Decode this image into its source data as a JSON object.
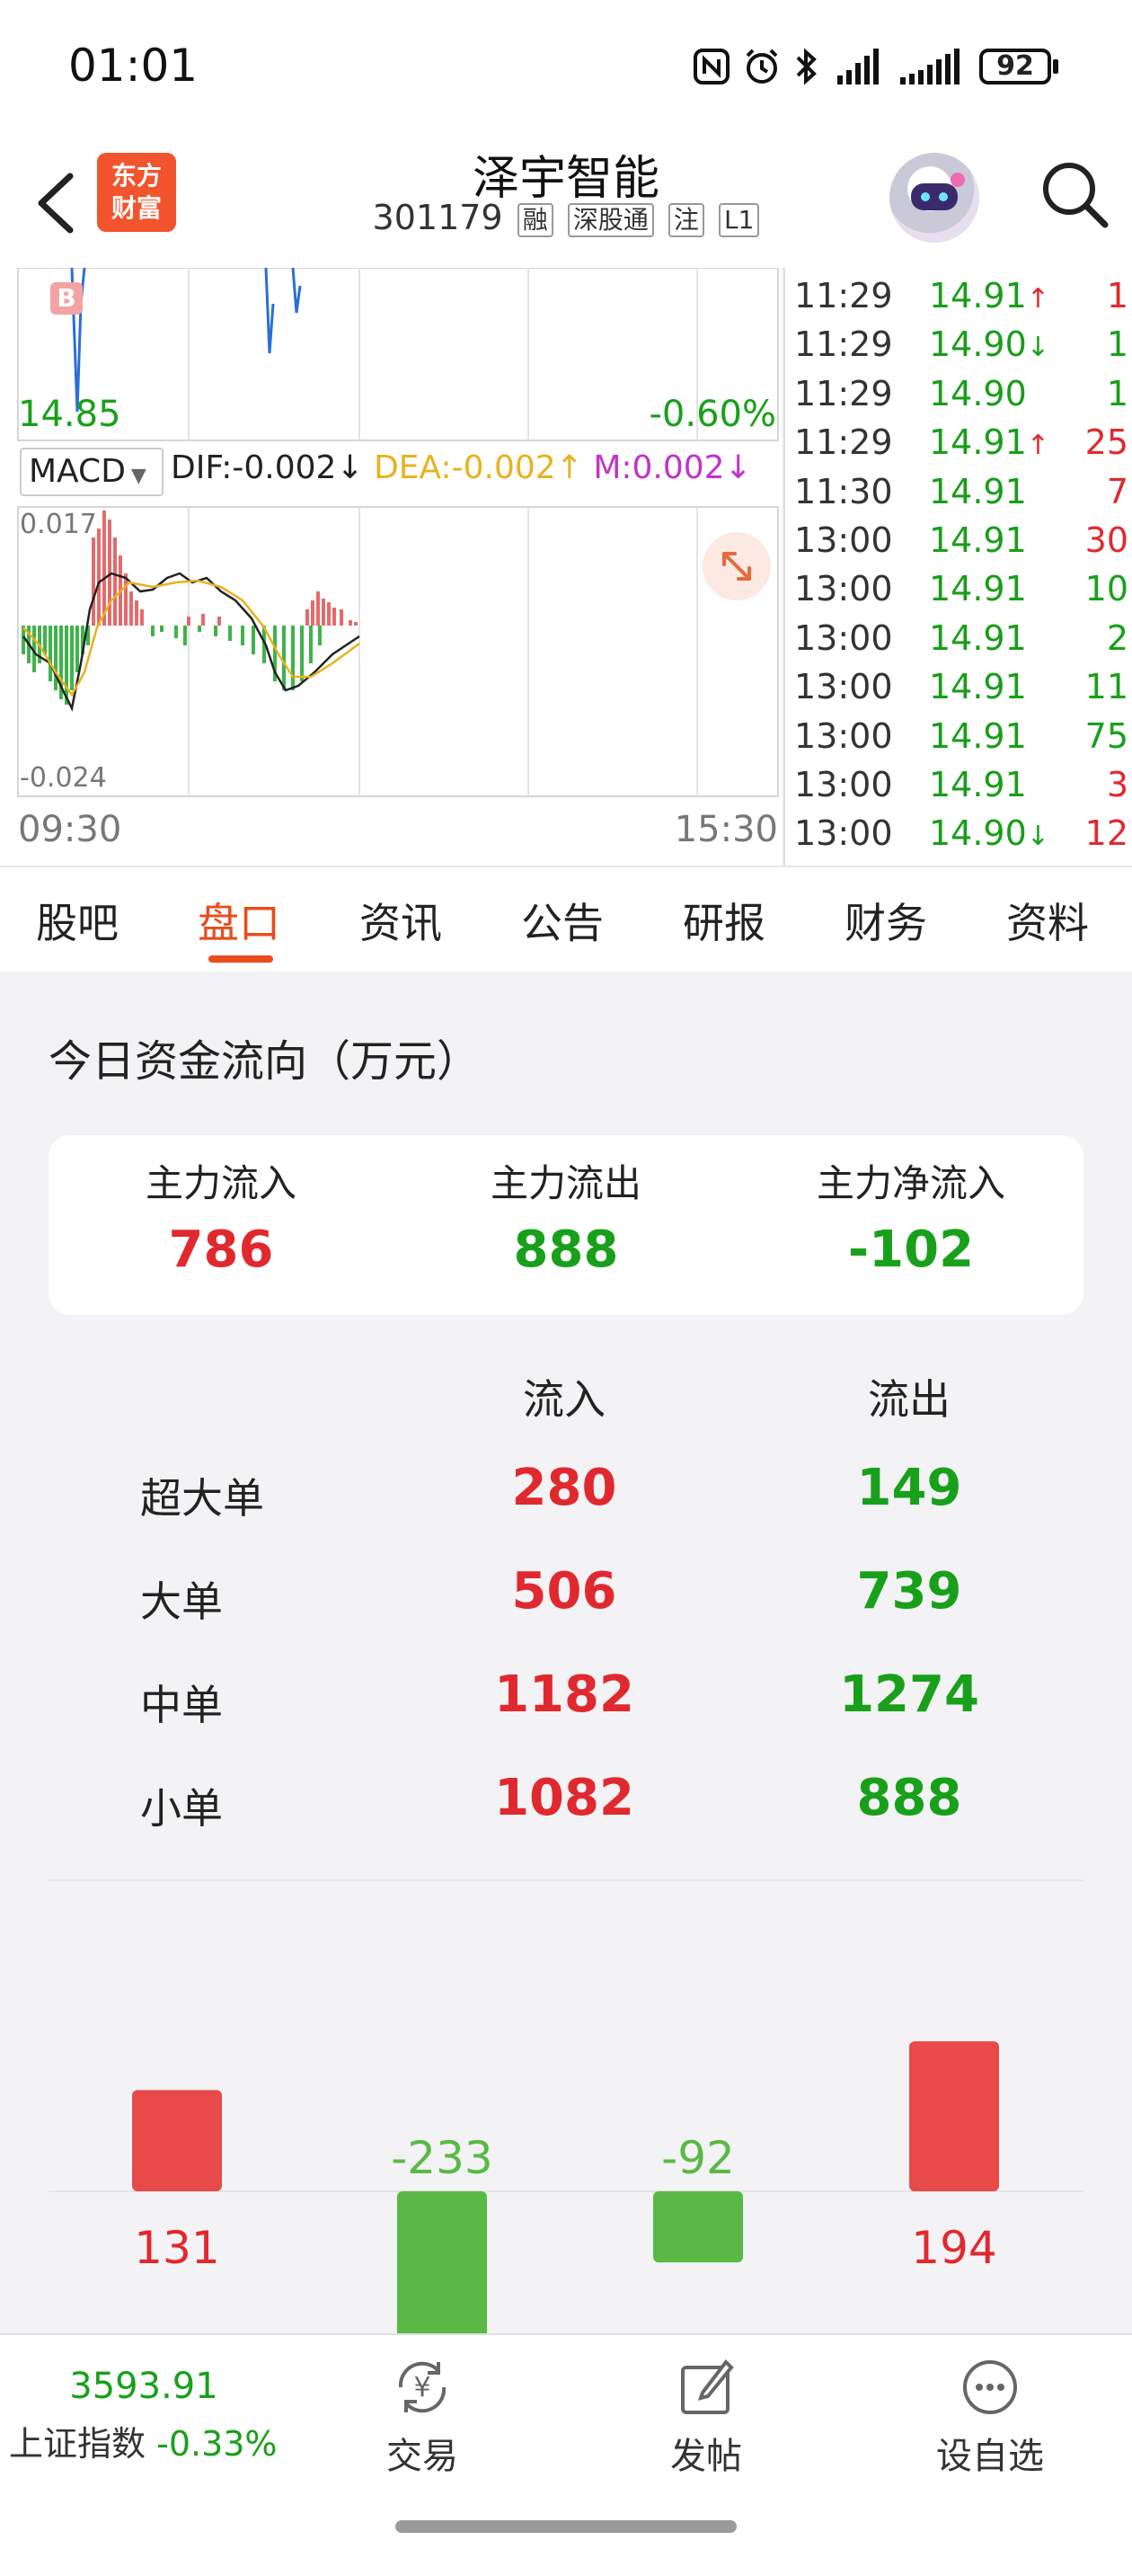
{
  "status_bar": {
    "time": "01:01",
    "battery": "92"
  },
  "header": {
    "logo_text_line1": "东方",
    "logo_text_line2": "财富",
    "stock_name": "泽宇智能",
    "stock_code": "301179",
    "tags": [
      "融",
      "深股通",
      "注",
      "L1"
    ]
  },
  "price_chart": {
    "low_price": "14.85",
    "change_pct": "-0.60%",
    "marker": "B"
  },
  "macd": {
    "selector": "MACD",
    "dif": "DIF:-0.002",
    "dif_arrow": "↓",
    "dea": "DEA:-0.002",
    "dea_arrow": "↑",
    "m": "M:0.002",
    "m_arrow": "↓",
    "y_max": "0.017",
    "y_min": "-0.024",
    "time_start": "09:30",
    "time_end": "15:30"
  },
  "ticks": [
    {
      "time": "11:29",
      "price": "14.91",
      "arrow": "↑",
      "vol": "1",
      "vol_color": "red"
    },
    {
      "time": "11:29",
      "price": "14.90",
      "arrow": "↓",
      "vol": "1",
      "vol_color": "green"
    },
    {
      "time": "11:29",
      "price": "14.90",
      "arrow": "",
      "vol": "1",
      "vol_color": "green"
    },
    {
      "time": "11:29",
      "price": "14.91",
      "arrow": "↑",
      "vol": "25",
      "vol_color": "red"
    },
    {
      "time": "11:30",
      "price": "14.91",
      "arrow": "",
      "vol": "7",
      "vol_color": "red"
    },
    {
      "time": "13:00",
      "price": "14.91",
      "arrow": "",
      "vol": "30",
      "vol_color": "red"
    },
    {
      "time": "13:00",
      "price": "14.91",
      "arrow": "",
      "vol": "10",
      "vol_color": "green"
    },
    {
      "time": "13:00",
      "price": "14.91",
      "arrow": "",
      "vol": "2",
      "vol_color": "green"
    },
    {
      "time": "13:00",
      "price": "14.91",
      "arrow": "",
      "vol": "11",
      "vol_color": "green"
    },
    {
      "time": "13:00",
      "price": "14.91",
      "arrow": "",
      "vol": "75",
      "vol_color": "green"
    },
    {
      "time": "13:00",
      "price": "14.91",
      "arrow": "",
      "vol": "3",
      "vol_color": "red"
    },
    {
      "time": "13:00",
      "price": "14.90",
      "arrow": "↓",
      "vol": "12",
      "vol_color": "red"
    }
  ],
  "tabs": [
    "股吧",
    "盘口",
    "资讯",
    "公告",
    "研报",
    "财务",
    "资料"
  ],
  "active_tab": "盘口",
  "fund_flow": {
    "title": "今日资金流向（万元）",
    "summary": [
      {
        "label": "主力流入",
        "value": "786",
        "color": "red"
      },
      {
        "label": "主力流出",
        "value": "888",
        "color": "green"
      },
      {
        "label": "主力净流入",
        "value": "-102",
        "color": "green"
      }
    ],
    "col_in": "流入",
    "col_out": "流出",
    "rows": [
      {
        "label": "超大单",
        "in": "280",
        "out": "149"
      },
      {
        "label": "大单",
        "in": "506",
        "out": "739"
      },
      {
        "label": "中单",
        "in": "1182",
        "out": "1274"
      },
      {
        "label": "小单",
        "in": "1082",
        "out": "888"
      }
    ]
  },
  "chart_data": {
    "type": "bar",
    "categories": [
      "",
      "",
      "",
      ""
    ],
    "values": [
      131,
      -233,
      -92,
      194
    ],
    "value_labels": [
      "131",
      "-233",
      "-92",
      "194"
    ],
    "colors": {
      "positive": "#e84a4a",
      "negative": "#5ab946"
    }
  },
  "bottom_bar": {
    "index_value": "3593.91",
    "index_name": "上证指数",
    "index_change": "-0.33%",
    "buttons": [
      {
        "label": "交易",
        "icon": "yuan-exchange-icon"
      },
      {
        "label": "发帖",
        "icon": "edit-post-icon"
      },
      {
        "label": "设自选",
        "icon": "more-dots-icon"
      }
    ]
  }
}
